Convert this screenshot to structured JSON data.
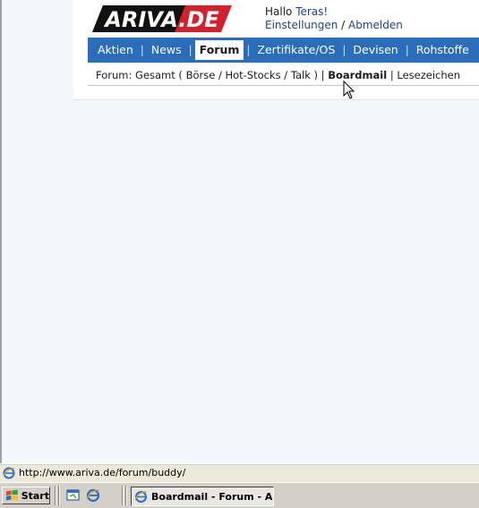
{
  "logo": {
    "text": "ARIVA.DE"
  },
  "greeting": {
    "hello": "Hallo ",
    "username": "Teras!",
    "settings": "Einstellungen",
    "separator": " / ",
    "logout": "Abmelden"
  },
  "mainnav": {
    "items": [
      {
        "label": "Aktien",
        "active": false
      },
      {
        "label": "News",
        "active": false
      },
      {
        "label": "Forum",
        "active": true
      },
      {
        "label": "Zertifikate/OS",
        "active": false
      },
      {
        "label": "Devisen",
        "active": false
      },
      {
        "label": "Rohstoffe",
        "active": false
      }
    ],
    "separator": "|"
  },
  "subnav": {
    "prefix": "Forum: ",
    "gesamt": "Gesamt",
    "open_paren": " ( ",
    "boerse": "Börse",
    "slash1": " / ",
    "hotstocks": "Hot-Stocks",
    "slash2": " / ",
    "talk": "Talk",
    "close_paren": " ) | ",
    "boardmail": "Boardmail",
    "pipe": " | ",
    "lesezeichen": "Lesezeichen"
  },
  "statusbar": {
    "url": "http://www.ariva.de/forum/buddy/"
  },
  "taskbar": {
    "start_label": "Start",
    "task_label": "Boardmail - Forum - A..."
  },
  "colors": {
    "nav_blue": "#2b6dbd",
    "page_bg": "#f3f8fd",
    "link": "#1c4597",
    "logo_red": "#d3202a"
  },
  "icons": [
    "windows-flag-icon",
    "show-desktop-icon",
    "internet-explorer-icon",
    "mouse-cursor-icon"
  ]
}
